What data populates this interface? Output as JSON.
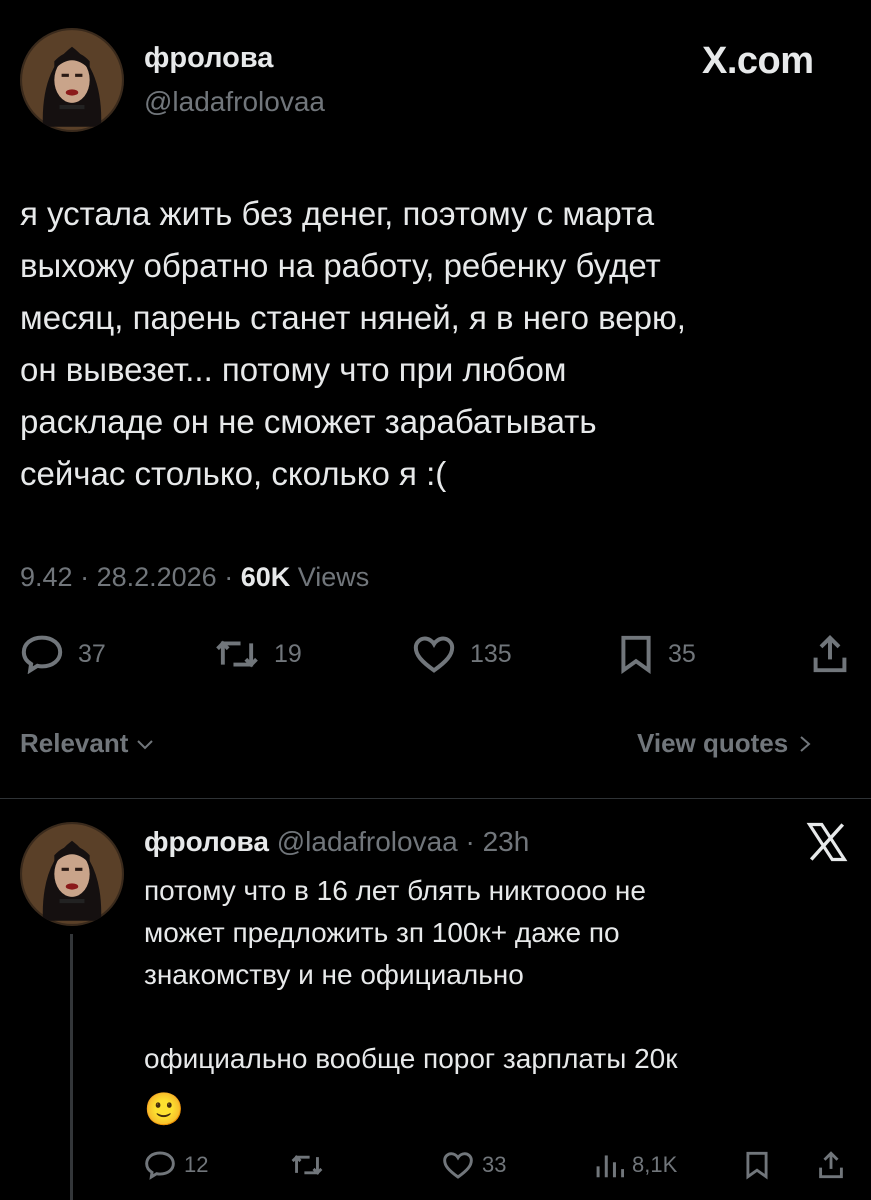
{
  "header": {
    "display_name": "фролова",
    "handle": "@ladafrolovaa",
    "brand": "X.com"
  },
  "tweet": {
    "text": "я устала жить без денег, поэтому с марта\nвыхожу обратно на работу, ребенку будет\nмесяц, парень станет няней, я в него верю,\nон вывезет... потому что при любом\nраскладе он не сможет зарабатывать\nсейчас столько, сколько я :(",
    "time": "9.42",
    "date": "28.2.2026",
    "views_count": "60K",
    "views_label": "Views",
    "actions": {
      "replies": "37",
      "reposts": "19",
      "likes": "135",
      "bookmarks": "35"
    }
  },
  "sort": {
    "label": "Relevant",
    "view_quotes": "View quotes"
  },
  "reply": {
    "display_name": "фролова",
    "handle": "@ladafrolovaa",
    "age": "23h",
    "text": "потому что в 16 лет блять никтоооо не\nможет предложить зп 100к+ даже по\nзнакомству и не официально\n\nофициально вообще порог зарплаты 20к",
    "emoji": "🙂",
    "actions": {
      "replies": "12",
      "likes": "33",
      "views": "8,1K"
    }
  },
  "colors": {
    "background": "#000000",
    "text": "#e7e9ea",
    "muted": "#71767b",
    "divider": "#2f3336"
  }
}
